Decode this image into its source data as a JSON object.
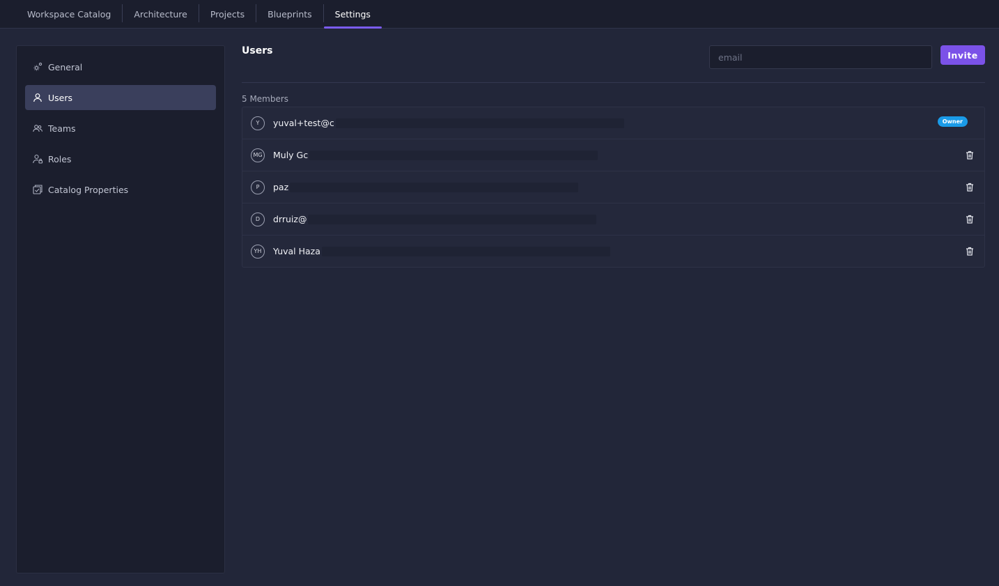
{
  "topnav": {
    "tabs": [
      {
        "label": "Workspace Catalog",
        "active": false
      },
      {
        "label": "Architecture",
        "active": false
      },
      {
        "label": "Projects",
        "active": false
      },
      {
        "label": "Blueprints",
        "active": false
      },
      {
        "label": "Settings",
        "active": true
      }
    ]
  },
  "sidebar": {
    "items": [
      {
        "label": "General",
        "icon": "gear-icon",
        "active": false
      },
      {
        "label": "Users",
        "icon": "user-icon",
        "active": true
      },
      {
        "label": "Teams",
        "icon": "team-icon",
        "active": false
      },
      {
        "label": "Roles",
        "icon": "user-lock-icon",
        "active": false
      },
      {
        "label": "Catalog Properties",
        "icon": "catalog-check-icon",
        "active": false
      }
    ]
  },
  "main": {
    "title": "Users",
    "invite": {
      "placeholder": "email",
      "value": "",
      "button_label": "Invite"
    },
    "members_count": "5 Members",
    "members": [
      {
        "initials": "Y",
        "name": "yuval+test@c",
        "badge": "Owner"
      },
      {
        "initials": "MG",
        "name": "Muly Gc",
        "badge": ""
      },
      {
        "initials": "P",
        "name": "paz",
        "badge": ""
      },
      {
        "initials": "D",
        "name": "drruiz@",
        "badge": ""
      },
      {
        "initials": "YH",
        "name": "Yuval Haza",
        "badge": ""
      }
    ]
  },
  "colors": {
    "accent": "#7b52e8",
    "owner_badge": "#1a9be8",
    "background": "#222639",
    "sidebar": "#1b1e2d"
  }
}
